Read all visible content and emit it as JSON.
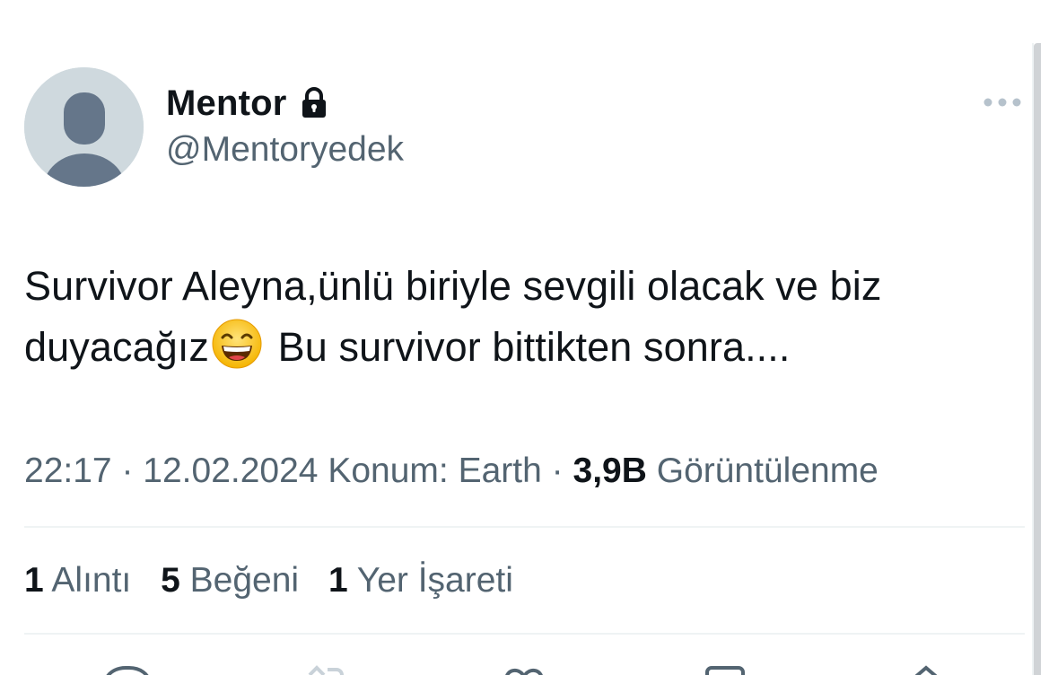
{
  "user": {
    "display_name": "Mentor",
    "handle": "@Mentoryedek",
    "avatar_icon": "default-avatar-icon",
    "protected_icon": "lock-icon"
  },
  "tweet": {
    "text_before_emoji": "Survivor Aleyna,ünlü biriyle sevgili olacak ve biz duyacağız",
    "emoji": "grinning-face-with-smiling-eyes-emoji",
    "text_after_emoji": "Bu survivor bittikten sonra...."
  },
  "meta": {
    "time": "22:17",
    "separator": "·",
    "date": "12.02.2024",
    "location": "Konum: Earth",
    "views_count": "3,9B",
    "views_label": "Görüntülenme"
  },
  "stats": [
    {
      "count": "1",
      "label": "Alıntı"
    },
    {
      "count": "5",
      "label": "Beğeni"
    },
    {
      "count": "1",
      "label": "Yer İşareti"
    }
  ],
  "colors": {
    "text_primary": "#0f1419",
    "text_secondary": "#536471",
    "divider": "#eff3f4",
    "avatar_bg": "#cfd9de",
    "avatar_fg": "#65768a"
  }
}
